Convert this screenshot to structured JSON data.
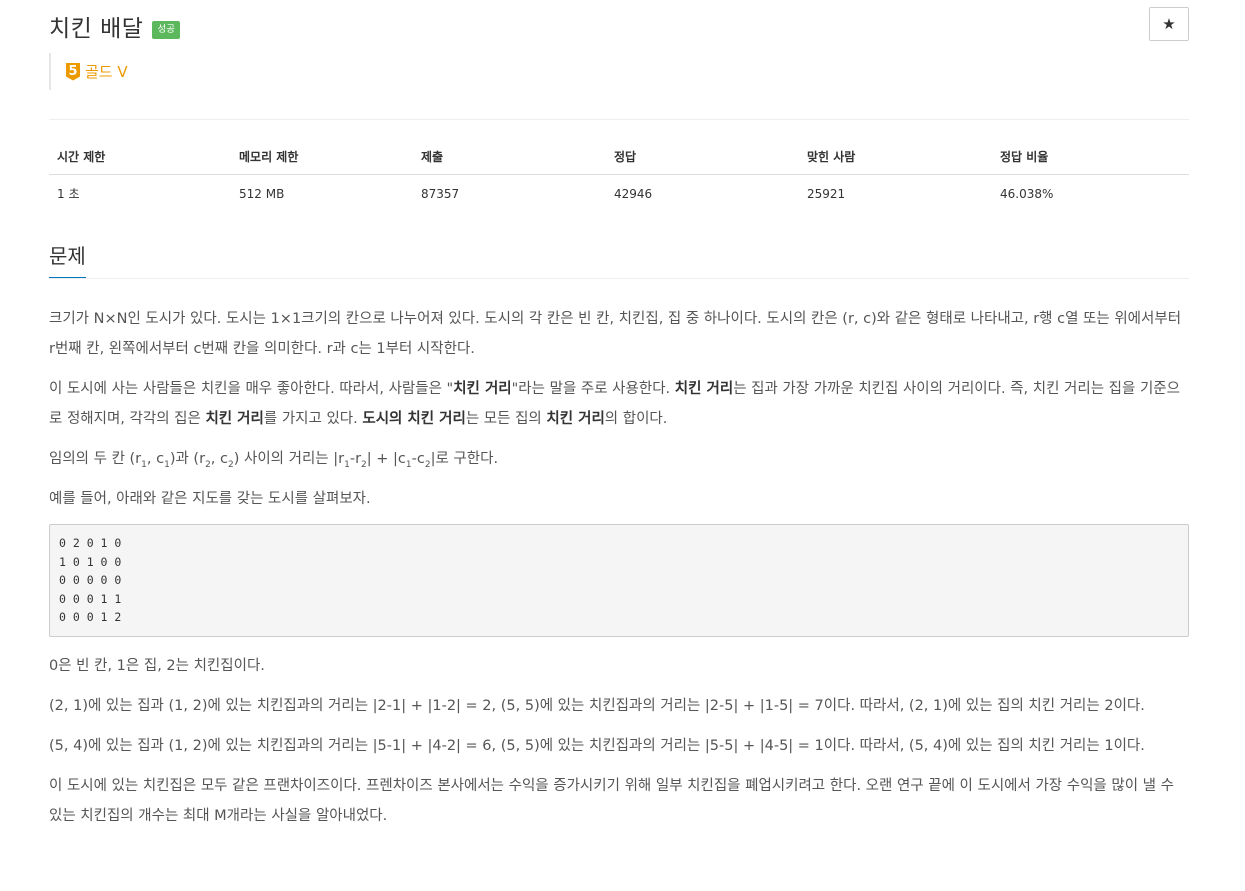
{
  "problem": {
    "title": "치킨 배달",
    "status_badge": "성공",
    "star_icon": "★",
    "tier": {
      "number": "5",
      "label": "골드 V",
      "color": "#ec9a00"
    }
  },
  "stats": {
    "headers": [
      "시간 제한",
      "메모리 제한",
      "제출",
      "정답",
      "맞힌 사람",
      "정답 비율"
    ],
    "values": [
      "1 초",
      "512 MB",
      "87357",
      "42946",
      "25921",
      "46.038%"
    ]
  },
  "section": {
    "title": "문제"
  },
  "description": {
    "p1": "크기가 N×N인 도시가 있다. 도시는 1×1크기의 칸으로 나누어져 있다. 도시의 각 칸은 빈 칸, 치킨집, 집 중 하나이다. 도시의 칸은 (r, c)와 같은 형태로 나타내고, r행 c열 또는 위에서부터 r번째 칸, 왼쪽에서부터 c번째 칸을 의미한다. r과 c는 1부터 시작한다.",
    "p2": {
      "t1": "이 도시에 사는 사람들은 치킨을 매우 좋아한다. 따라서, 사람들은 \"",
      "b1": "치킨 거리",
      "t2": "\"라는 말을 주로 사용한다. ",
      "b2": "치킨 거리",
      "t3": "는 집과 가장 가까운 치킨집 사이의 거리이다. 즉, 치킨 거리는 집을 기준으로 정해지며, 각각의 집은 ",
      "b3": "치킨 거리",
      "t4": "를 가지고 있다. ",
      "b4": "도시의 치킨 거리",
      "t5": "는 모든 집의 ",
      "b5": "치킨 거리",
      "t6": "의 합이다."
    },
    "p3": {
      "t1": "임의의 두 칸 (r",
      "s1": "1",
      "t2": ", c",
      "s2": "1",
      "t3": ")과 (r",
      "s3": "2",
      "t4": ", c",
      "s4": "2",
      "t5": ") 사이의 거리는 |r",
      "s5": "1",
      "t6": "-r",
      "s6": "2",
      "t7": "| + |c",
      "s7": "1",
      "t8": "-c",
      "s8": "2",
      "t9": "|로 구한다."
    },
    "p4": "예를 들어, 아래와 같은 지도를 갖는 도시를 살펴보자.",
    "sample": "0 2 0 1 0\n1 0 1 0 0\n0 0 0 0 0\n0 0 0 1 1\n0 0 0 1 2",
    "p5": "0은 빈 칸, 1은 집, 2는 치킨집이다.",
    "p6": "(2, 1)에 있는 집과 (1, 2)에 있는 치킨집과의 거리는 |2-1| + |1-2| = 2, (5, 5)에 있는 치킨집과의 거리는 |2-5| + |1-5| = 7이다. 따라서, (2, 1)에 있는 집의 치킨 거리는 2이다.",
    "p7": "(5, 4)에 있는 집과 (1, 2)에 있는 치킨집과의 거리는 |5-1| + |4-2| = 6, (5, 5)에 있는 치킨집과의 거리는 |5-5| + |4-5| = 1이다. 따라서, (5, 4)에 있는 집의 치킨 거리는 1이다.",
    "p8": "이 도시에 있는 치킨집은 모두 같은 프랜차이즈이다. 프렌차이즈 본사에서는 수익을 증가시키기 위해 일부 치킨집을 폐업시키려고 한다. 오랜 연구 끝에 이 도시에서 가장 수익을 많이 낼 수 있는  치킨집의 개수는 최대 M개라는 사실을 알아내었다."
  }
}
